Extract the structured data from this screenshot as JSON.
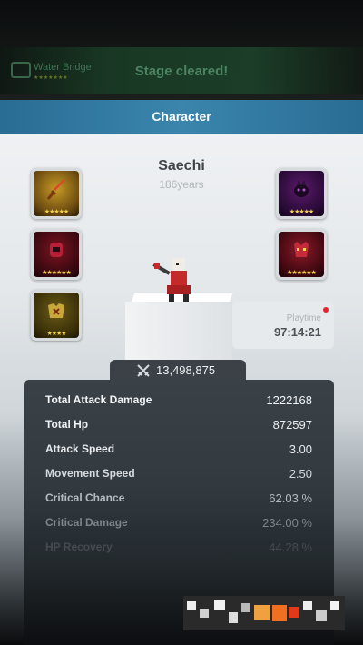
{
  "toast": {
    "stage_name": "Water Bridge",
    "stage_stars": "★★★★★★★",
    "message": "Stage cleared!"
  },
  "panel": {
    "title": "Character"
  },
  "character": {
    "name": "Saechi",
    "age": "186years"
  },
  "equipment": [
    {
      "slot": "weapon",
      "icon": "sword-icon",
      "stars": "★★★★★"
    },
    {
      "slot": "helmet",
      "icon": "helmet-icon",
      "stars": "★★★★★★"
    },
    {
      "slot": "armor",
      "icon": "armor-icon",
      "stars": "★★★★"
    },
    {
      "slot": "pet",
      "icon": "dark-creature-icon",
      "stars": "★★★★★"
    },
    {
      "slot": "accessory",
      "icon": "demon-mask-icon",
      "stars": "★★★★★★"
    }
  ],
  "playtime": {
    "label": "Playtime",
    "value": "97:14:21"
  },
  "combat_power": {
    "icon": "crossed-swords-icon",
    "value": "13,498,875"
  },
  "stats": [
    {
      "label": "Total Attack Damage",
      "value": "1222168"
    },
    {
      "label": "Total Hp",
      "value": "872597"
    },
    {
      "label": "Attack Speed",
      "value": "3.00"
    },
    {
      "label": "Movement Speed",
      "value": "2.50"
    },
    {
      "label": "Critical Chance",
      "value": "62.03 %"
    },
    {
      "label": "Critical Damage",
      "value": "234.00 %"
    },
    {
      "label": "HP Recovery",
      "value": "44.28 %"
    }
  ]
}
